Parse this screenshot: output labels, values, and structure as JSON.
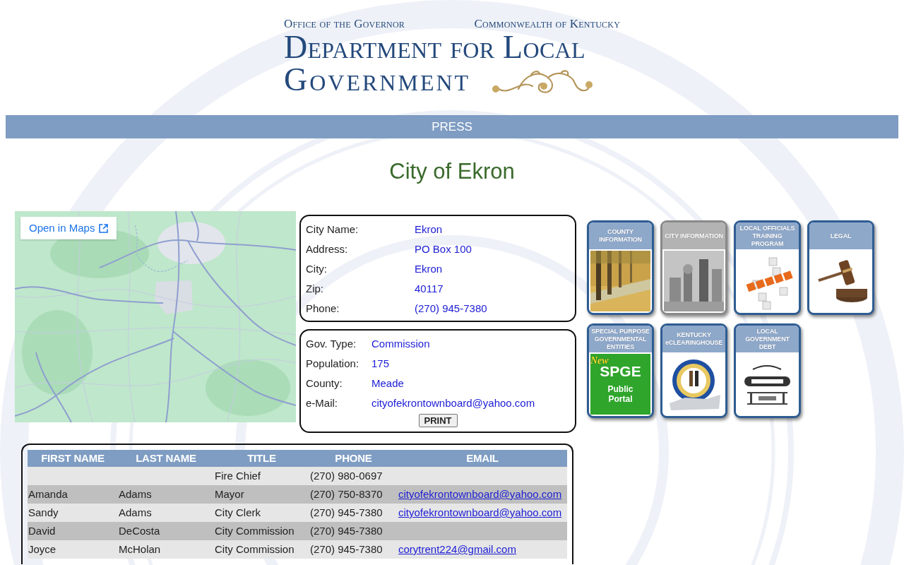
{
  "header": {
    "office": "Office of the Governor",
    "state": "Commonwealth of Kentucky",
    "title_lines": [
      "Department for Local",
      "Government"
    ]
  },
  "nav": {
    "items": [
      {
        "label": "PRESS"
      }
    ]
  },
  "page_title": "City of Ekron",
  "map": {
    "link": "Open in Maps"
  },
  "city_info": [
    {
      "label": "City Name:",
      "value": "Ekron"
    },
    {
      "label": "Address:",
      "value": "PO Box 100"
    },
    {
      "label": "City:",
      "value": "Ekron"
    },
    {
      "label": "Zip:",
      "value": "40117"
    },
    {
      "label": "Phone:",
      "value": "(270) 945-7380"
    }
  ],
  "gov_info": {
    "fields": [
      {
        "label": "Gov. Type:",
        "value": "Commission"
      },
      {
        "label": "Population:",
        "value": "175"
      },
      {
        "label": "County:",
        "value": "Meade"
      },
      {
        "label": "e-Mail:",
        "value": "cityofekrontownboard@yahoo.com"
      }
    ],
    "print_button": "PRINT"
  },
  "tiles": [
    {
      "title": "COUNTY INFORMATION",
      "kind": "photo",
      "selected": false
    },
    {
      "title": "CITY INFORMATION",
      "kind": "photo",
      "selected": true
    },
    {
      "title": "LOCAL OFFICIALS TRAINING PROGRAM",
      "kind": "photo",
      "selected": false
    },
    {
      "title": "LEGAL",
      "kind": "photo",
      "selected": false
    },
    {
      "title": "SPECIAL PURPOSE GOVERNMENTAL ENTITIES",
      "kind": "portal",
      "selected": false,
      "badge": "New",
      "heading": "SPGE",
      "subtitle": "Public Portal"
    },
    {
      "title": "KENTUCKY eCLEARINGHOUSE",
      "kind": "photo",
      "selected": false
    },
    {
      "title": "LOCAL GOVERNMENT DEBT",
      "kind": "photo",
      "selected": false
    }
  ],
  "officials": {
    "columns": [
      "FIRST NAME",
      "LAST NAME",
      "TITLE",
      "PHONE",
      "EMAIL"
    ],
    "rows": [
      {
        "title": "Fire Chief",
        "phone": "(270) 980-0697"
      },
      {
        "first_name": "Amanda",
        "last_name": "Adams",
        "title": "Mayor",
        "phone": "(270) 750-8370",
        "email": "cityofekrontownboard@yahoo.com"
      },
      {
        "first_name": "Sandy",
        "last_name": "Adams",
        "title": "City Clerk",
        "phone": "(270) 945-7380",
        "email": "cityofekrontownboard@yahoo.com"
      },
      {
        "first_name": "David",
        "last_name": "DeCosta",
        "title": "City Commission",
        "phone": "(270) 945-7380"
      },
      {
        "first_name": "Joyce",
        "last_name": "McHolan",
        "title": "City Commission",
        "phone": "(270) 945-7380",
        "email": "corytrent224@gmail.com"
      }
    ]
  }
}
